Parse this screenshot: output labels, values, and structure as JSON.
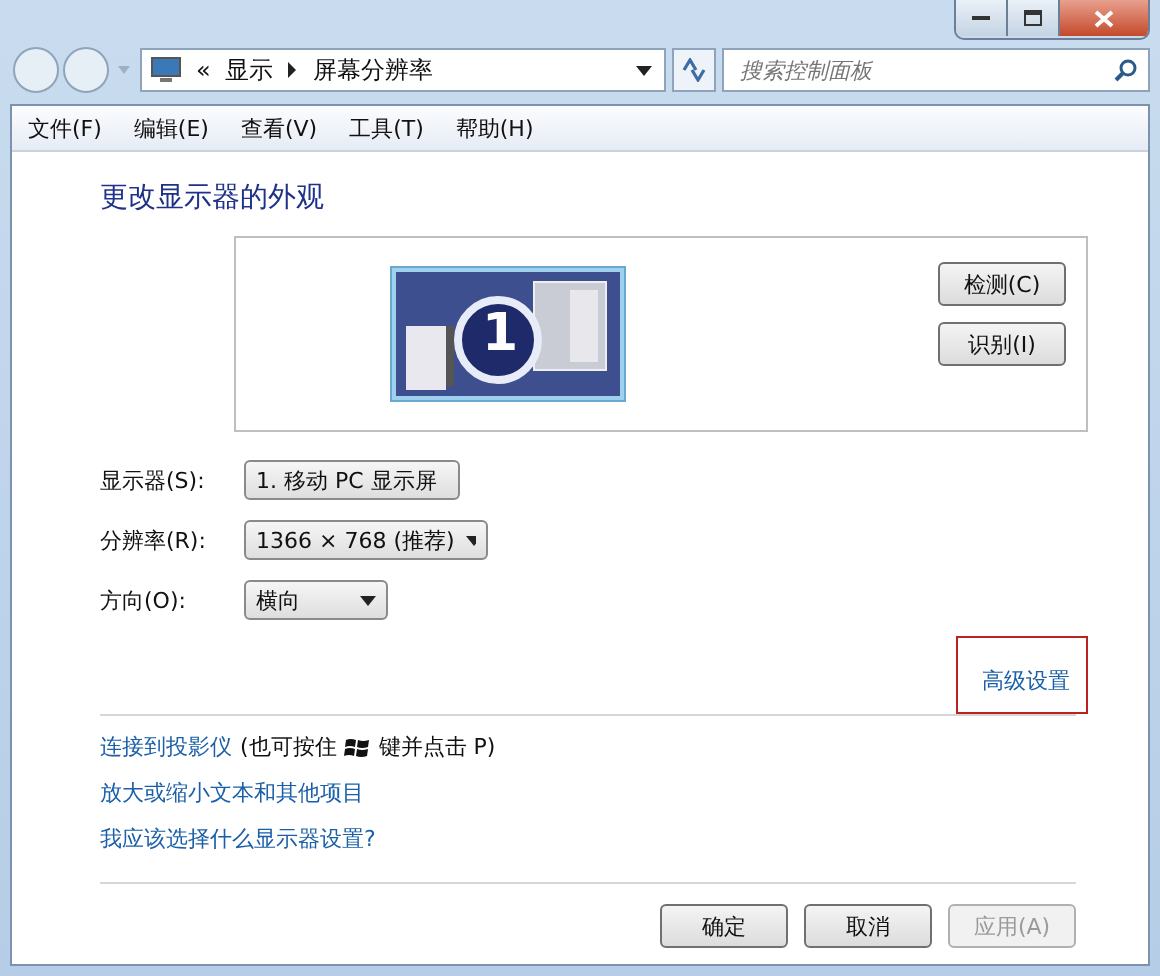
{
  "address_bar": {
    "overflow": "«",
    "crumbs": [
      "显示",
      "屏幕分辨率"
    ]
  },
  "search": {
    "placeholder": "搜索控制面板"
  },
  "menu": [
    "文件(F)",
    "编辑(E)",
    "查看(V)",
    "工具(T)",
    "帮助(H)"
  ],
  "heading": "更改显示器的外观",
  "preview": {
    "monitor_number": "1",
    "buttons": [
      "检测(C)",
      "识别(I)"
    ]
  },
  "settings": [
    {
      "label": "显示器(S):",
      "value": "1. 移动 PC 显示屏"
    },
    {
      "label": "分辨率(R):",
      "value": "1366 × 768 (推荐)"
    },
    {
      "label": "方向(O):",
      "value": "横向"
    }
  ],
  "advanced_link": {
    "label": "高级设置",
    "highlighted": true
  },
  "projector": {
    "link": "连接到投影仪",
    "before_key": "(也可按住",
    "after_key": "键并点击 P)"
  },
  "links": [
    "放大或缩小文本和其他项目",
    "我应该选择什么显示器设置?"
  ],
  "buttons": [
    {
      "label": "确定",
      "disabled": false
    },
    {
      "label": "取消",
      "disabled": false
    },
    {
      "label": "应用(A)",
      "disabled": true
    }
  ]
}
